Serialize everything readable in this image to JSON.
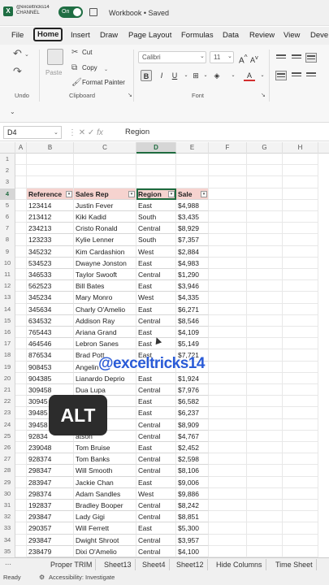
{
  "titlebar": {
    "channel": "@exceltricks14 CHANNEL",
    "autosave": "On",
    "workbook_title": "Workbook • Saved"
  },
  "tabs": [
    "File",
    "Home",
    "Insert",
    "Draw",
    "Page Layout",
    "Formulas",
    "Data",
    "Review",
    "View",
    "Deve"
  ],
  "ribbon": {
    "undo_label": "Undo",
    "paste_label": "Paste",
    "cut_label": "Cut",
    "copy_label": "Copy",
    "format_painter_label": "Format Painter",
    "clipboard_label": "Clipboard",
    "font_name": "Calibri",
    "font_size": "11",
    "font_label": "Font"
  },
  "formula_bar": {
    "name_box": "D4",
    "content": "Region"
  },
  "columns": [
    "A",
    "B",
    "C",
    "D",
    "E",
    "F",
    "G",
    "H"
  ],
  "selected_cell": "D4",
  "table": {
    "headers": [
      "Reference",
      "Sales Rep",
      "Region",
      "Sale"
    ],
    "rows": [
      [
        "123414",
        "Justin Fever",
        "East",
        "$4,988"
      ],
      [
        "213412",
        "Kiki Kadid",
        "South",
        "$3,435"
      ],
      [
        "234213",
        "Cristo Ronald",
        "Central",
        "$8,929"
      ],
      [
        "123233",
        "Kylie Lenner",
        "South",
        "$7,357"
      ],
      [
        "345232",
        "Kim Cardashion",
        "West",
        "$2,884"
      ],
      [
        "534523",
        "Dwayne Jonston",
        "East",
        "$4,983"
      ],
      [
        "346533",
        "Taylor Swooft",
        "Central",
        "$1,290"
      ],
      [
        "562523",
        "Bill Bates",
        "East",
        "$3,946"
      ],
      [
        "345234",
        "Mary Monro",
        "West",
        "$4,335"
      ],
      [
        "345634",
        "Charly O'Amelio",
        "East",
        "$6,271"
      ],
      [
        "634532",
        "Addison Ray",
        "Central",
        "$8,546"
      ],
      [
        "765443",
        "Ariana Grand",
        "East",
        "$4,109"
      ],
      [
        "464546",
        "Lebron Sanes",
        "East",
        "$5,149"
      ],
      [
        "876534",
        "Brad Pott",
        "East",
        "$7,721"
      ],
      [
        "908453",
        "Angelin",
        "",
        ""
      ],
      [
        "904385",
        "Lianardo Deprio",
        "East",
        "$1,924"
      ],
      [
        "309458",
        "Dua Lupa",
        "Central",
        "$7,976"
      ],
      [
        "30945",
        "enner",
        "East",
        "$6,582"
      ],
      [
        "39485",
        "Daze",
        "East",
        "$6,237"
      ],
      [
        "39458",
        "eep",
        "Central",
        "$8,909"
      ],
      [
        "92834",
        "atson",
        "Central",
        "$4,767"
      ],
      [
        "239048",
        "Tom Bruise",
        "East",
        "$2,452"
      ],
      [
        "928374",
        "Tom Banks",
        "Central",
        "$2,598"
      ],
      [
        "298347",
        "Will Smooth",
        "Central",
        "$8,106"
      ],
      [
        "283947",
        "Jackie Chan",
        "East",
        "$9,006"
      ],
      [
        "298374",
        "Adam Sandles",
        "West",
        "$9,886"
      ],
      [
        "192837",
        "Bradley Booper",
        "Central",
        "$8,242"
      ],
      [
        "293847",
        "Lady Gigi",
        "Central",
        "$8,851"
      ],
      [
        "290357",
        "Will Ferrett",
        "East",
        "$5,300"
      ],
      [
        "293847",
        "Dwight Shroot",
        "Central",
        "$3,957"
      ],
      [
        "238479",
        "Dixi O'Amelio",
        "Central",
        "$4,100"
      ],
      [
        "",
        "",
        "",
        ""
      ]
    ]
  },
  "row_numbers": [
    "1",
    "2",
    "3",
    "4",
    "5",
    "6",
    "7",
    "8",
    "9",
    "10",
    "11",
    "12",
    "13",
    "14",
    "15",
    "16",
    "17",
    "18",
    "19",
    "20",
    "21",
    "22",
    "23",
    "24",
    "25",
    "26",
    "27",
    "28",
    "29",
    "30",
    "31",
    "32",
    "33",
    "34",
    "35",
    "36"
  ],
  "overlay": {
    "watermark": "@exceltricks14",
    "key_hint": "ALT"
  },
  "sheet_tabs": [
    "Proper TRIM",
    "Sheet13",
    "Sheet4",
    "Sheet12",
    "Hide Columns",
    "Time Sheet"
  ],
  "status": {
    "ready": "Ready",
    "accessibility": "Accessibility: Investigate"
  }
}
